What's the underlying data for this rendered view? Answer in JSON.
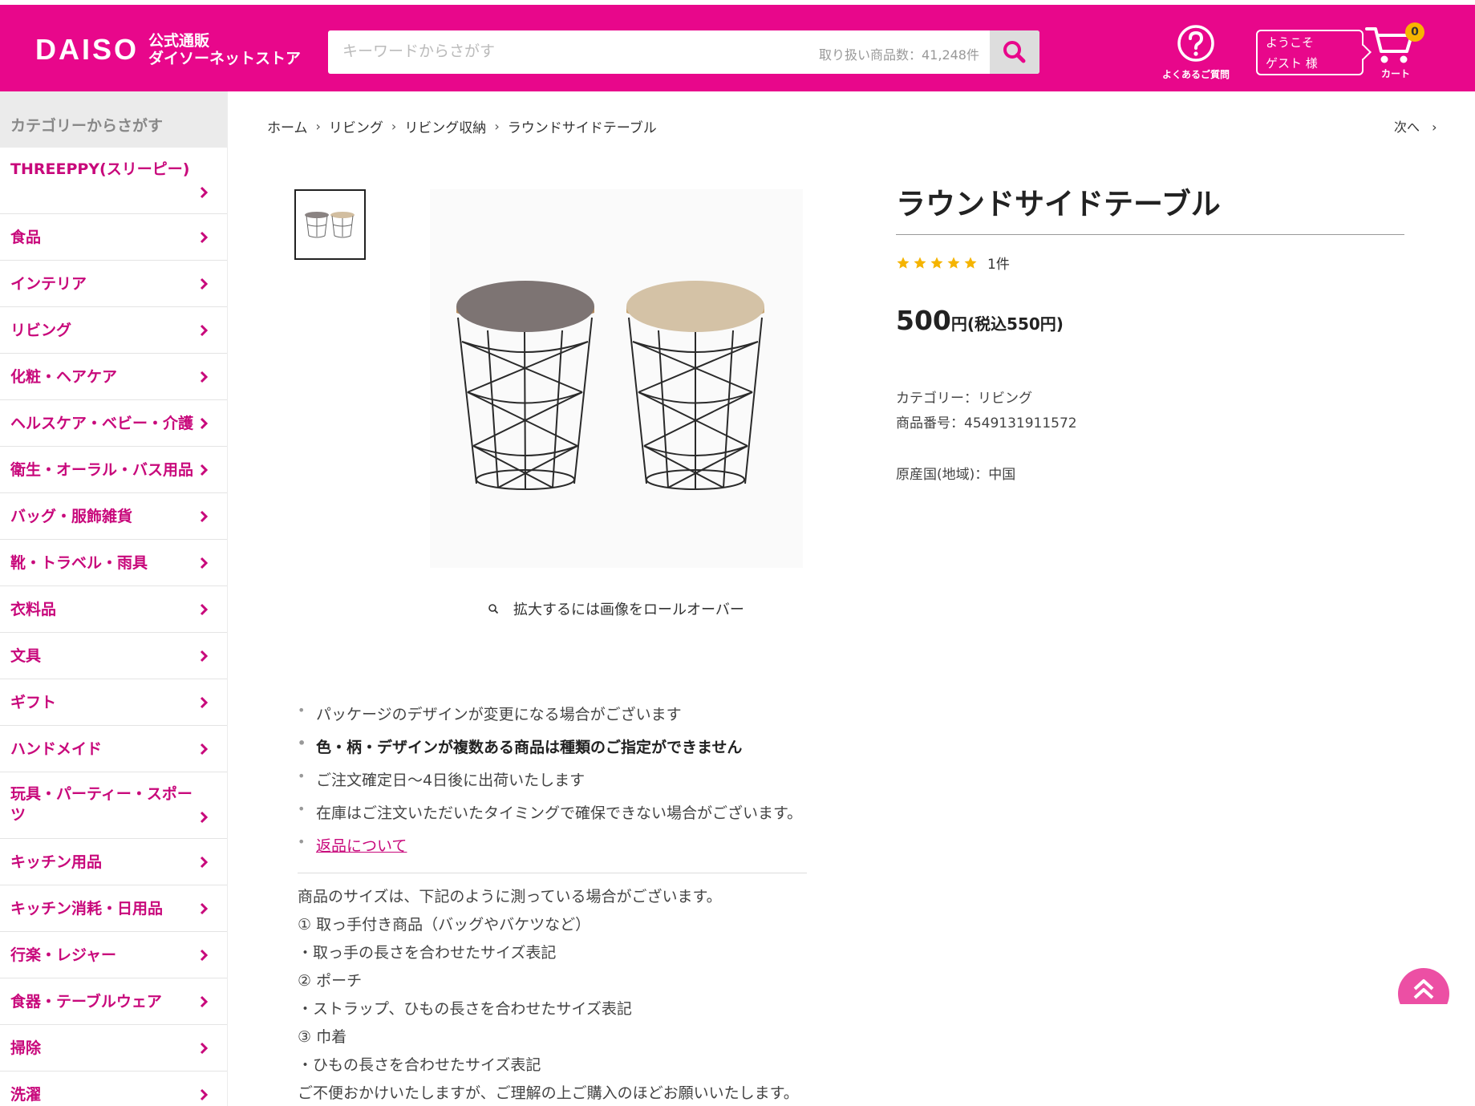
{
  "header": {
    "logo_main": "DAISO",
    "logo_sub_1": "公式通販",
    "logo_sub_2": "ダイソーネットストア",
    "search_placeholder": "キーワードからさがす",
    "search_count": "取り扱い商品数：41,248件",
    "faq_label": "よくあるご質問",
    "welcome_line1": "ようこそ",
    "welcome_line2": "ゲスト 様",
    "cart_badge": "0",
    "cart_label": "カート",
    "brand_color": "#e8078b"
  },
  "sidebar": {
    "title": "カテゴリーからさがす",
    "items": [
      {
        "label": "THREEPPY(スリーピー)"
      },
      {
        "label": "食品"
      },
      {
        "label": "インテリア"
      },
      {
        "label": "リビング"
      },
      {
        "label": "化粧・ヘアケア"
      },
      {
        "label": "ヘルスケア・ベビー・介護"
      },
      {
        "label": "衛生・オーラル・バス用品"
      },
      {
        "label": "バッグ・服飾雑貨"
      },
      {
        "label": "靴・トラベル・雨具"
      },
      {
        "label": "衣料品"
      },
      {
        "label": "文具"
      },
      {
        "label": "ギフト"
      },
      {
        "label": "ハンドメイド"
      },
      {
        "label": "玩具・パーティー・スポーツ"
      },
      {
        "label": "キッチン用品"
      },
      {
        "label": "キッチン消耗・日用品"
      },
      {
        "label": "行楽・レジャー"
      },
      {
        "label": "食器・テーブルウェア"
      },
      {
        "label": "掃除"
      },
      {
        "label": "洗濯"
      }
    ]
  },
  "breadcrumb": {
    "items": [
      "ホーム",
      "リビング",
      "リビング収納",
      "ラウンドサイドテーブル"
    ],
    "next": "次へ"
  },
  "gallery": {
    "zoom_hint": "拡大するには画像をロールオーバー"
  },
  "product": {
    "title": "ラウンドサイドテーブル",
    "rating": 5,
    "review_count": "1件",
    "price_main": "500",
    "price_suffix": "円(税込550円)",
    "category": "カテゴリー：リビング",
    "product_number": "商品番号：4549131911572",
    "origin": "原産国(地域)：中国"
  },
  "notes": {
    "items": [
      "パッケージのデザインが変更になる場合がございます",
      "色・柄・デザインが複数ある商品は種類のご指定ができません",
      "ご注文確定日～4日後に出荷いたします",
      "在庫はご注文いただいたタイミングで確保できない場合がございます。"
    ],
    "returns_link": "返品について"
  },
  "sizes": {
    "lines": [
      "商品のサイズは、下記のように測っている場合がございます。",
      "① 取っ手付き商品（バッグやバケツなど）",
      "・取っ手の長さを合わせたサイズ表記",
      "② ポーチ",
      "・ストラップ、ひもの長さを合わせたサイズ表記",
      "③ 巾着",
      "・ひもの長さを合わせたサイズ表記",
      "ご不便おかけいたしますが、ご理解の上ご購入のほどお願いいたします。"
    ]
  }
}
